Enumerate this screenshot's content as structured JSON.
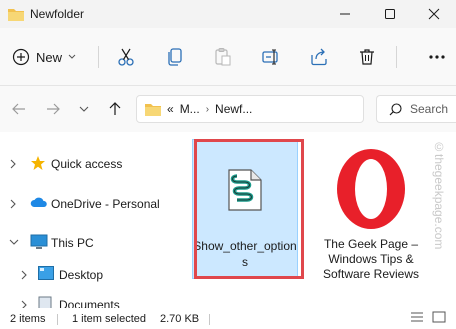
{
  "window": {
    "title": "Newfolder",
    "controls": [
      "minimize-icon",
      "maximize-icon",
      "close-icon"
    ]
  },
  "toolbar": {
    "new_label": "New",
    "icons": [
      "cut-icon",
      "copy-icon",
      "paste-icon",
      "rename-icon",
      "share-icon",
      "delete-icon",
      "more-icon"
    ]
  },
  "address": {
    "overflow": "«",
    "segments": [
      "M...",
      "Newf..."
    ]
  },
  "search": {
    "placeholder": "Search"
  },
  "navpane": {
    "items": [
      {
        "label": "Quick access",
        "icon": "star-icon"
      },
      {
        "label": "OneDrive - Personal",
        "icon": "cloud-icon"
      },
      {
        "label": "This PC",
        "icon": "monitor-icon"
      },
      {
        "label": "Desktop",
        "icon": "desktop-icon"
      },
      {
        "label": "Documents",
        "icon": "documents-icon"
      }
    ]
  },
  "files": [
    {
      "name": "Show_other_options",
      "icon": "registry-script-icon",
      "selected": true
    },
    {
      "name": "The Geek Page – Windows Tips & Software Reviews",
      "icon": "opera-icon",
      "selected": false
    }
  ],
  "status": {
    "items_count": "2 items",
    "selection": "1 item selected",
    "size": "2.70 KB"
  },
  "watermark": "©thegeekpage.com",
  "colors": {
    "selection_bg": "#cce8ff",
    "highlight_border": "#e0474c",
    "folder_yellow": "#f2c14e",
    "opera_red": "#e8202a"
  }
}
